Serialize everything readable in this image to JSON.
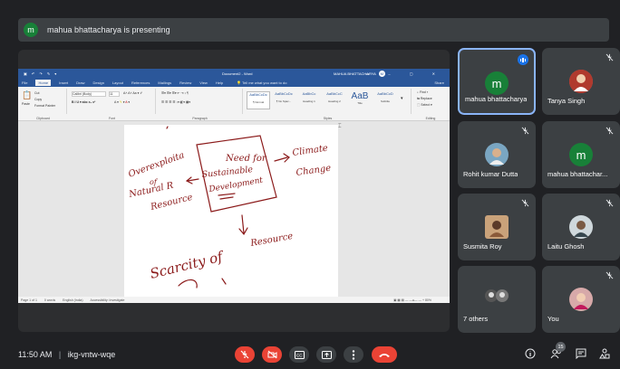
{
  "banner": {
    "avatar_letter": "m",
    "text": "mahua bhattacharya is presenting"
  },
  "word": {
    "doc_title": "Document2 - Word",
    "user_name": "MAHUA BHATTACHARYA",
    "user_initial": "M",
    "tabs": [
      "File",
      "Home",
      "Insert",
      "Draw",
      "Design",
      "Layout",
      "References",
      "Mailings",
      "Review",
      "View",
      "Help"
    ],
    "tell_me": "Tell me what you want to do",
    "share": "Share",
    "ribbon": {
      "clipboard": {
        "paste": "Paste",
        "cut": "Cut",
        "copy": "Copy",
        "format_painter": "Format Painter",
        "label": "Clipboard"
      },
      "font": {
        "font_name": "Calibri (Body)",
        "font_size": "11",
        "label": "Font"
      },
      "paragraph": {
        "label": "Paragraph"
      },
      "styles": {
        "label": "Styles",
        "items": [
          {
            "sample": "AaBbCcDc",
            "name": "¶ Normal"
          },
          {
            "sample": "AaBbCcDc",
            "name": "¶ No Spac..."
          },
          {
            "sample": "AaBbCc",
            "name": "Heading 1"
          },
          {
            "sample": "AaBbCcC",
            "name": "Heading 2"
          },
          {
            "sample": "AaB",
            "name": "Title"
          },
          {
            "sample": "AaBbCcD",
            "name": "Subtitle"
          }
        ]
      },
      "editing": {
        "find": "Find",
        "replace": "Replace",
        "select": "Select",
        "label": "Editing"
      }
    },
    "handwriting": {
      "box_line1": "Need for",
      "box_line2": "Sustainable",
      "box_line3": "Development",
      "left_line1": "Overexploita",
      "left_line2": "of",
      "left_line3": "Natural R",
      "left_line4": "Resource",
      "right_line1": "Climate",
      "right_line2": "Change",
      "bottom_line1": "Scarcity of",
      "bottom_line2": "Resource"
    },
    "status": {
      "page": "Page 1 of 1",
      "words": "0 words",
      "lang": "English (India)",
      "accessibility": "Accessibility: Investigate",
      "zoom": "80%"
    }
  },
  "participants": [
    {
      "name": "mahua bhattacharya",
      "initial": "m",
      "color": "#188038",
      "speaking": true
    },
    {
      "name": "Tanya Singh",
      "photo": true,
      "muted": true
    },
    {
      "name": "Rohit kumar Dutta",
      "photo": true,
      "muted": true
    },
    {
      "name": "mahua bhattachar...",
      "initial": "m",
      "color": "#188038",
      "muted": true
    },
    {
      "name": "Susmita Roy",
      "photo": true,
      "muted": true
    },
    {
      "name": "Laitu Ghosh",
      "photo": true,
      "muted": true
    },
    {
      "name": "7 others",
      "photo": true
    },
    {
      "name": "You",
      "photo": true,
      "muted": true
    }
  ],
  "bottom": {
    "time": "11:50 AM",
    "separator": "|",
    "meeting_code": "ikg-vntw-wqe",
    "people_count": "15"
  }
}
